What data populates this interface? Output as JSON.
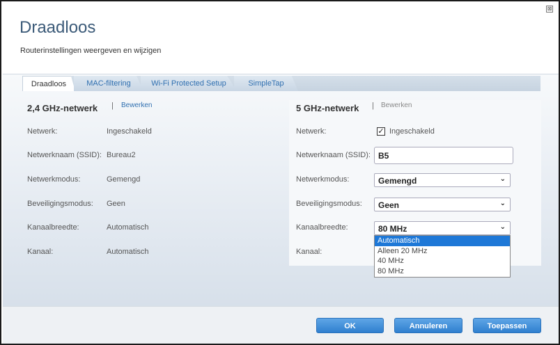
{
  "window": {
    "close_icon": "close-icon",
    "close_glyph": "⊠",
    "title": "Draadloos",
    "subtitle": "Routerinstellingen weergeven en wijzigen"
  },
  "tabs": [
    {
      "label": "Draadloos",
      "active": true
    },
    {
      "label": "MAC-filtering",
      "active": false
    },
    {
      "label": "Wi-Fi Protected Setup",
      "active": false
    },
    {
      "label": "SimpleTap",
      "active": false
    }
  ],
  "band24": {
    "title": "2,4 GHz-netwerk",
    "separator": "|",
    "edit": "Bewerken",
    "rows": [
      {
        "label": "Netwerk:",
        "value": "Ingeschakeld"
      },
      {
        "label": "Netwerknaam (SSID):",
        "value": "Bureau2"
      },
      {
        "label": "Netwerkmodus:",
        "value": "Gemengd"
      },
      {
        "label": "Beveiligingsmodus:",
        "value": "Geen"
      },
      {
        "label": "Kanaalbreedte:",
        "value": "Automatisch"
      },
      {
        "label": "Kanaal:",
        "value": "Automatisch"
      }
    ]
  },
  "band5": {
    "title": "5 GHz-netwerk",
    "separator": "|",
    "edit": "Bewerken",
    "network_label": "Netwerk:",
    "network_checked": true,
    "check_glyph": "✓",
    "network_value": "Ingeschakeld",
    "ssid_label": "Netwerknaam (SSID):",
    "ssid_value": "B5",
    "mode_label": "Netwerkmodus:",
    "mode_value": "Gemengd",
    "security_label": "Beveiligingsmodus:",
    "security_value": "Geen",
    "width_label": "Kanaalbreedte:",
    "width_value": "80 MHz",
    "channel_label": "Kanaal:",
    "chevron_glyph": "⌄",
    "width_options": [
      "Automatisch",
      "Alleen 20 MHz",
      "40 MHz",
      "80 MHz"
    ],
    "highlighted_option": "Automatisch"
  },
  "footer": {
    "ok": "OK",
    "cancel": "Annuleren",
    "apply": "Toepassen"
  },
  "colors": {
    "accent": "#2f7fcf",
    "title": "#3b5a78",
    "link": "#2f6fb0",
    "selection": "#1e78d7"
  }
}
